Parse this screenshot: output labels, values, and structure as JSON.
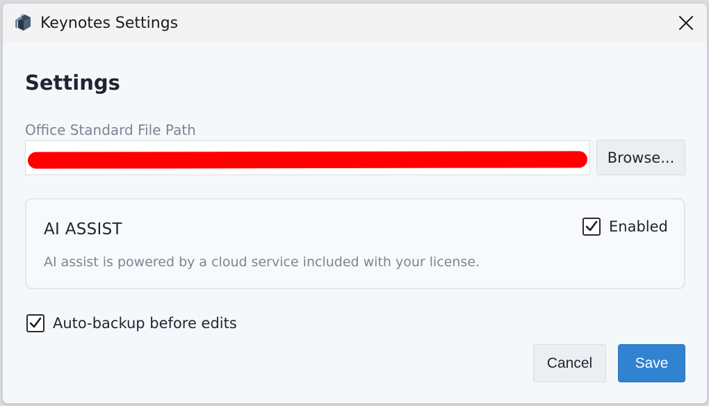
{
  "window": {
    "title": "Keynotes Settings",
    "app_icon": "keynotes-app-icon",
    "close_icon": "close-icon"
  },
  "settings": {
    "heading": "Settings",
    "file_path": {
      "label": "Office Standard File Path",
      "value": "",
      "browse_label": "Browse..."
    },
    "ai_assist": {
      "title": "AI ASSIST",
      "description": "AI assist is powered by a cloud service included with your license.",
      "enabled_label": "Enabled",
      "enabled": true
    },
    "auto_backup": {
      "label": "Auto-backup before edits",
      "checked": true
    }
  },
  "footer": {
    "cancel_label": "Cancel",
    "save_label": "Save"
  },
  "colors": {
    "accent": "#3182d1",
    "redaction": "#ff0000"
  }
}
